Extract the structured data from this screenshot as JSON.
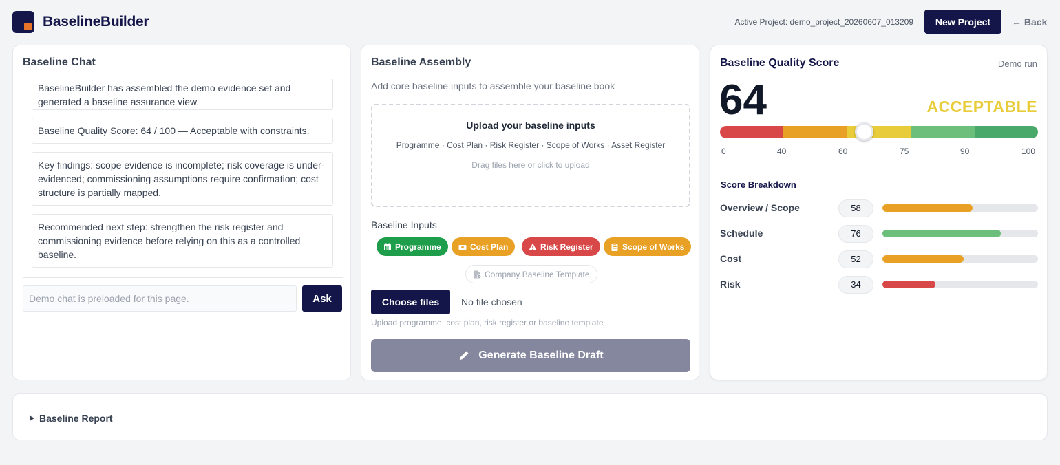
{
  "header": {
    "brand": "BaselineBuilder",
    "active_project": "Active Project: demo_project_20260607_013209",
    "new_project_label": "New Project",
    "back_label": "← Back"
  },
  "chat": {
    "title": "Baseline Chat",
    "messages": [
      "BaselineBuilder has assembled the demo evidence set and generated a baseline assurance view.",
      "Baseline Quality Score: 64 / 100 — Acceptable with constraints.",
      "Key findings: scope evidence is incomplete; risk coverage is under-evidenced; commissioning assumptions require confirmation; cost structure is partially mapped.",
      "Recommended next step: strengthen the risk register and commissioning evidence before relying on this as a controlled baseline."
    ],
    "input_placeholder": "Demo chat is preloaded for this page.",
    "ask_label": "Ask"
  },
  "assembly": {
    "title": "Baseline Assembly",
    "subtitle": "Add core baseline inputs to assemble your baseline book",
    "dropzone": {
      "title": "Upload your baseline inputs",
      "types": "Programme · Cost Plan · Risk Register · Scope of Works · Asset Register",
      "hint": "Drag files here or click to upload"
    },
    "inputs_label": "Baseline Inputs",
    "pills": [
      {
        "label": "Programme",
        "icon": "calendar-icon",
        "color": "#1e9e4a"
      },
      {
        "label": "Cost Plan",
        "icon": "money-icon",
        "color": "#e8a125"
      },
      {
        "label": "Risk Register",
        "icon": "warning-icon",
        "color": "#d94848"
      },
      {
        "label": "Scope of Works",
        "icon": "clipboard-icon",
        "color": "#e8a125"
      },
      {
        "label": "Company Baseline Template",
        "icon": "file-check-icon",
        "color": "#9ca3af"
      }
    ],
    "choose_files_label": "Choose files",
    "no_file_text": "No file chosen",
    "upload_hint": "Upload programme, cost plan, risk register or baseline template",
    "generate_label": "Generate Baseline Draft"
  },
  "score": {
    "title": "Baseline Quality Score",
    "mode": "Demo run",
    "value": "64",
    "status": "ACCEPTABLE",
    "gauge_ticks": [
      "0",
      "40",
      "60",
      "75",
      "90",
      "100"
    ],
    "gauge_value": 64,
    "gauge_colors": [
      "#d94848",
      "#e8a125",
      "#e8cc3a",
      "#6cbf7a",
      "#48a96a"
    ],
    "breakdown_title": "Score Breakdown",
    "breakdown": [
      {
        "label": "Overview / Scope",
        "value": "58",
        "percent": 58,
        "color": "#e8a125"
      },
      {
        "label": "Schedule",
        "value": "76",
        "percent": 76,
        "color": "#6cbf7a"
      },
      {
        "label": "Cost",
        "value": "52",
        "percent": 52,
        "color": "#e8a125"
      },
      {
        "label": "Risk",
        "value": "34",
        "percent": 34,
        "color": "#d94848"
      }
    ]
  },
  "report": {
    "label": "Baseline Report"
  }
}
